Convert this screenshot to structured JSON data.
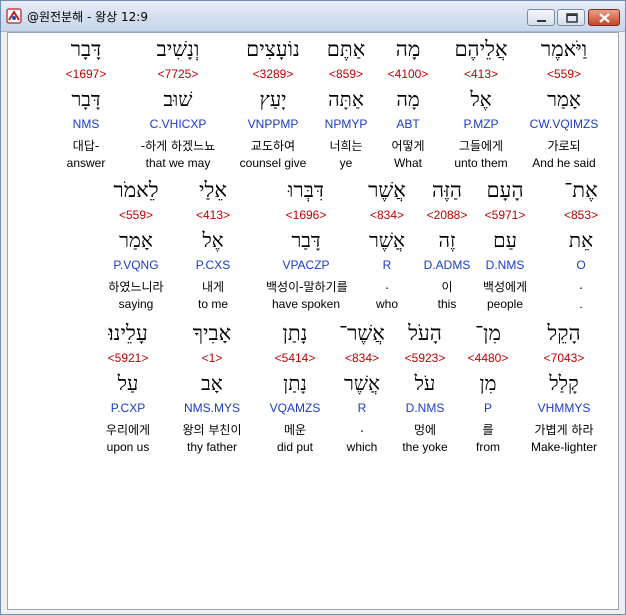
{
  "window": {
    "title": "@원전분해 - 왕상 12:9"
  },
  "rows": [
    {
      "words": [
        {
          "heb": "וַיֹּאמֶר",
          "num": "<559>",
          "root": "אָמַר",
          "parse": "CW.VQIMZS",
          "kor": "가로되",
          "eng": "And he said"
        },
        {
          "heb": "אֲלֵיהֶם",
          "num": "<413>",
          "root": "אֶל",
          "parse": "P.MZP",
          "kor": "그들에게",
          "eng": "unto them"
        },
        {
          "heb": "מָה",
          "num": "<4100>",
          "root": "מָה",
          "parse": "ABT",
          "kor": "어떻게",
          "eng": "What"
        },
        {
          "heb": "אַתֶּם",
          "num": "<859>",
          "root": "אַתָּה",
          "parse": "NPMYP",
          "kor": "너희는",
          "eng": "ye"
        },
        {
          "heb": "נוֹעָצִים",
          "num": "<3289>",
          "root": "יָעַץ",
          "parse": "VNPPMP",
          "kor": "교도하여",
          "eng": "counsel give"
        },
        {
          "heb": "וְנָשִׁיב",
          "num": "<7725>",
          "root": "שׁוּב",
          "parse": "C.VHICXP",
          "kor": "-하게 하겠느뇨",
          "eng": "that we may"
        },
        {
          "heb": "דָּבָר",
          "num": "<1697>",
          "root": "דָּבָר",
          "parse": "NMS",
          "kor": "대답-",
          "eng": "answer"
        }
      ]
    },
    {
      "words": [
        {
          "heb": "אֶת־",
          "num": "<853>",
          "root": "אֵת",
          "parse": "O",
          "kor": ".",
          "eng": "."
        },
        {
          "heb": "הָעָם",
          "num": "<5971>",
          "root": "עַם",
          "parse": "D.NMS",
          "kor": "백성에게",
          "eng": "people"
        },
        {
          "heb": "הַזֶּה",
          "num": "<2088>",
          "root": "זֶה",
          "parse": "D.ADMS",
          "kor": "이",
          "eng": "this"
        },
        {
          "heb": "אֲשֶׁר",
          "num": "<834>",
          "root": "אֲשֶׁר",
          "parse": "R",
          "kor": ".",
          "eng": "who"
        },
        {
          "heb": "דִּבְּרוּ",
          "num": "<1696>",
          "root": "דָּבַר",
          "parse": "VPACZP",
          "kor": "백성이-말하기를",
          "eng": "have spoken"
        },
        {
          "heb": "אֵלַי",
          "num": "<413>",
          "root": "אֶל",
          "parse": "P.CXS",
          "kor": "내게",
          "eng": "to me"
        },
        {
          "heb": "לֵאמֹר",
          "num": "<559>",
          "root": "אָמַר",
          "parse": "P.VQNG",
          "kor": "하였느니라",
          "eng": "saying"
        }
      ]
    },
    {
      "words": [
        {
          "heb": "הָקֵל",
          "num": "<7043>",
          "root": "קָלַל",
          "parse": "VHMMYS",
          "kor": "가볍게 하라",
          "eng": "Make-lighter"
        },
        {
          "heb": "מִן־",
          "num": "<4480>",
          "root": "מִן",
          "parse": "P",
          "kor": "를",
          "eng": "from"
        },
        {
          "heb": "הָעֹל",
          "num": "<5923>",
          "root": "עֹל",
          "parse": "D.NMS",
          "kor": "멍에",
          "eng": "the yoke"
        },
        {
          "heb": "אֲשֶׁר־",
          "num": "<834>",
          "root": "אֲשֶׁר",
          "parse": "R",
          "kor": ".",
          "eng": "which"
        },
        {
          "heb": "נָתַן",
          "num": "<5414>",
          "root": "נָתַן",
          "parse": "VQAMZS",
          "kor": "메운",
          "eng": "did put"
        },
        {
          "heb": "אָבִיךָ",
          "num": "<1>",
          "root": "אָב",
          "parse": "NMS.MYS",
          "kor": "왕의 부친이",
          "eng": "thy father"
        },
        {
          "heb": "עָלֵינוּ׃",
          "num": "<5921>",
          "root": "עַל",
          "parse": "P.CXP",
          "kor": "우리에게",
          "eng": "upon us"
        }
      ]
    }
  ]
}
